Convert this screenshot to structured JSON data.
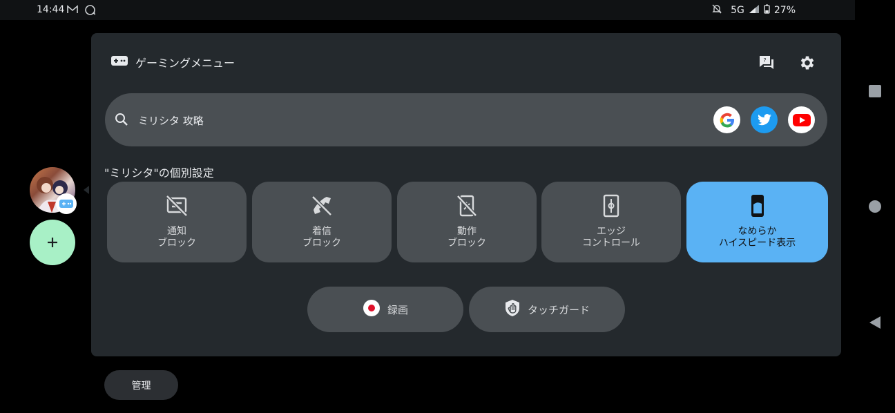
{
  "status_bar": {
    "time": "14:44",
    "network": "5G",
    "battery": "27%"
  },
  "panel": {
    "title": "ゲーミングメニュー",
    "header_icons": [
      "help-chat-icon",
      "settings-gear-icon"
    ]
  },
  "search": {
    "value": "ミリシタ 攻略",
    "engines": [
      "google",
      "twitter",
      "youtube"
    ]
  },
  "section_title": "\"ミリシタ\"の個別設定",
  "tiles": [
    {
      "label": "通知\nブロック",
      "icon": "notification-off-icon",
      "active": false
    },
    {
      "label": "着信\nブロック",
      "icon": "call-block-icon",
      "active": false
    },
    {
      "label": "動作\nブロック",
      "icon": "touch-block-icon",
      "active": false
    },
    {
      "label": "エッジ\nコントロール",
      "icon": "edge-control-icon",
      "active": false
    },
    {
      "label": "なめらか\nハイスピード表示",
      "icon": "smooth-display-icon",
      "active": true
    }
  ],
  "actions": {
    "record_label": "録画",
    "touch_guard_label": "タッチガード"
  },
  "sidebar": {
    "add_icon": "plus-icon"
  },
  "manage_label": "管理",
  "colors": {
    "panel_bg": "#24292d",
    "tile_bg": "#4a4f53",
    "active_tile": "#5ab2f4",
    "add_button": "#a8f0c6"
  }
}
